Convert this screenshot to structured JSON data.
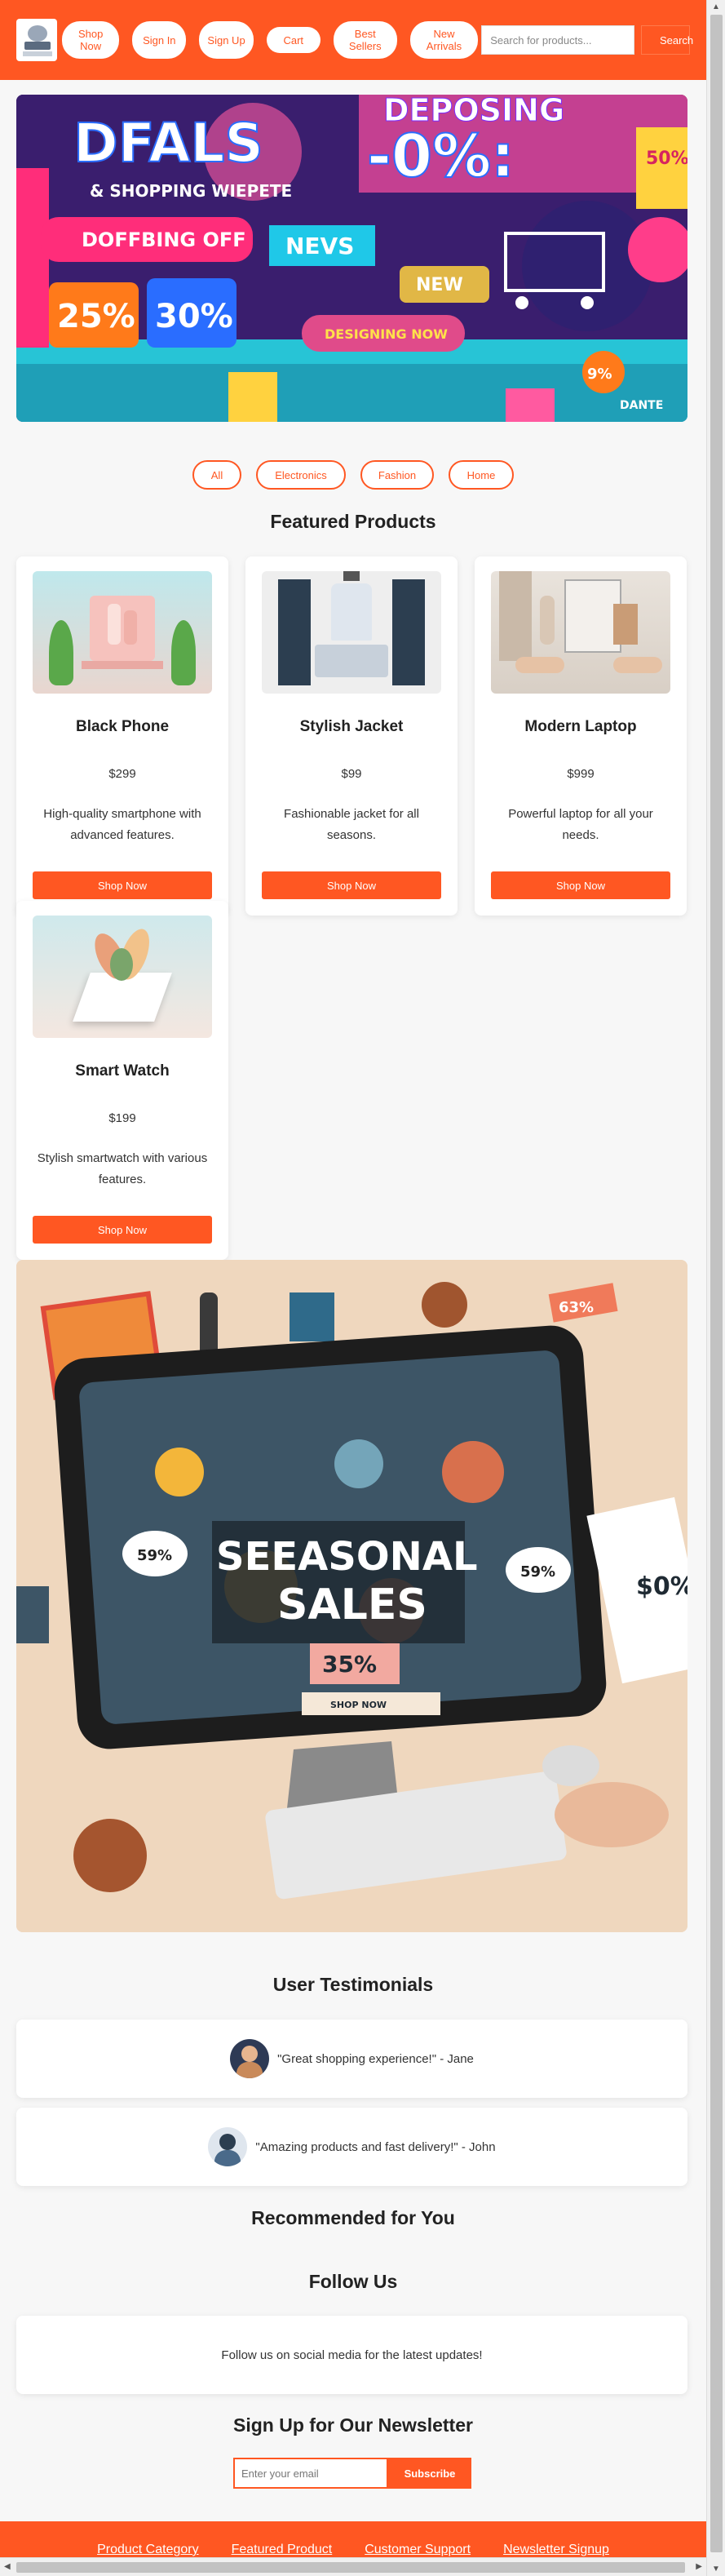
{
  "header": {
    "nav": [
      "Shop Now",
      "Sign In",
      "Sign Up",
      "Cart",
      "Best Sellers",
      "New Arrivals"
    ],
    "search_placeholder": "Search for products...",
    "search_button": "Search"
  },
  "hero": {
    "text_main": "DFALS",
    "text_sub": "& SHOPPING WIEPETE",
    "text_dep": "DEPOSING",
    "text_pct": "-0%:",
    "text_50": "50%",
    "text_off": "DOFFBING OFF",
    "text_news": "NEVS",
    "text_new": "NEW",
    "text_25": "25%",
    "text_30": "30%",
    "text_designing": "DESIGNING NOW",
    "text_9": "9%",
    "text_dante": "DANTE"
  },
  "filters": [
    "All",
    "Electronics",
    "Fashion",
    "Home"
  ],
  "featured_title": "Featured Products",
  "products": [
    {
      "name": "Black Phone",
      "price": "$299",
      "desc": "High-quality smartphone with advanced features.",
      "button": "Shop Now"
    },
    {
      "name": "Stylish Jacket",
      "price": "$99",
      "desc": "Fashionable jacket for all seasons.",
      "button": "Shop Now"
    },
    {
      "name": "Modern Laptop",
      "price": "$999",
      "desc": "Powerful laptop for all your needs.",
      "button": "Shop Now"
    },
    {
      "name": "Smart Watch",
      "price": "$199",
      "desc": "Stylish smartwatch with various features.",
      "button": "Shop Now"
    }
  ],
  "seasonal": {
    "title1": "SEEASONAL",
    "title2": "SALES",
    "pct_left": "59%",
    "pct_right": "59%",
    "pct_center": "35%",
    "tag": "63%",
    "side": "$0%",
    "shop": "SHOP NOW"
  },
  "testimonials_title": "User Testimonials",
  "testimonials": [
    "\"Great shopping experience!\" - Jane",
    "\"Amazing products and fast delivery!\" - John"
  ],
  "recommended_title": "Recommended for You",
  "follow_title": "Follow Us",
  "follow_text": "Follow us on social media for the latest updates!",
  "newsletter_title": "Sign Up for Our Newsletter",
  "newsletter_placeholder": "Enter your email",
  "newsletter_button": "Subscribe",
  "footer": [
    "Product Category",
    "Featured Product",
    "Customer Support",
    "Newsletter Signup"
  ],
  "colors": {
    "accent": "#ff5722",
    "background": "#f7f7f7"
  }
}
